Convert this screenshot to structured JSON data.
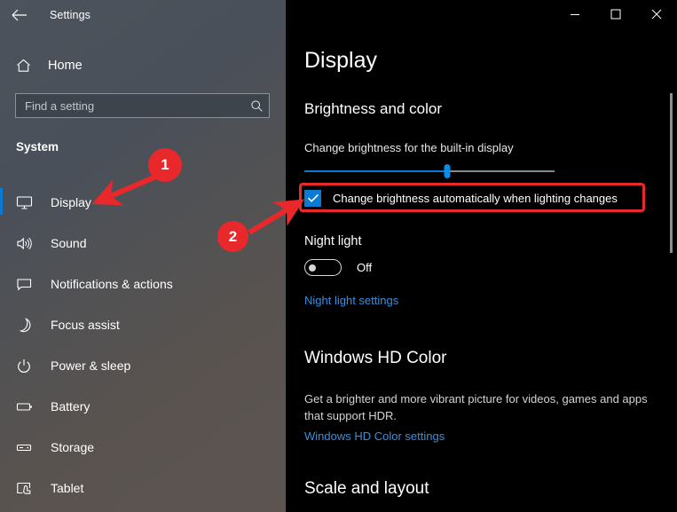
{
  "window": {
    "app_title": "Settings",
    "back_icon": "back-arrow-icon",
    "controls": {
      "minimize": "–",
      "maximize": "□",
      "close": "✕"
    }
  },
  "sidebar": {
    "home_label": "Home",
    "home_icon": "home-icon",
    "search": {
      "placeholder": "Find a setting",
      "value": "",
      "icon": "search-icon"
    },
    "section_title": "System",
    "items": [
      {
        "label": "Display",
        "icon": "monitor-icon",
        "selected": true
      },
      {
        "label": "Sound",
        "icon": "speaker-icon",
        "selected": false
      },
      {
        "label": "Notifications & actions",
        "icon": "notification-icon",
        "selected": false
      },
      {
        "label": "Focus assist",
        "icon": "moon-icon",
        "selected": false
      },
      {
        "label": "Power & sleep",
        "icon": "power-icon",
        "selected": false
      },
      {
        "label": "Battery",
        "icon": "battery-icon",
        "selected": false
      },
      {
        "label": "Storage",
        "icon": "storage-icon",
        "selected": false
      },
      {
        "label": "Tablet",
        "icon": "tablet-icon",
        "selected": false
      }
    ]
  },
  "main": {
    "page_title": "Display",
    "brightness": {
      "heading": "Brightness and color",
      "slider_label": "Change brightness for the built-in display",
      "slider_value": 57,
      "auto_checkbox_label": "Change brightness automatically when lighting changes",
      "auto_checkbox_checked": true
    },
    "night_light": {
      "heading": "Night light",
      "toggle_state": "Off",
      "toggle_on": false,
      "settings_link": "Night light settings"
    },
    "hd_color": {
      "heading": "Windows HD Color",
      "description": "Get a brighter and more vibrant picture for videos, games and apps that support HDR.",
      "settings_link": "Windows HD Color settings"
    },
    "scale": {
      "heading": "Scale and layout"
    }
  },
  "annotations": {
    "color": "#e8282b",
    "markers": [
      {
        "number": "1",
        "target": "sidebar-item-display"
      },
      {
        "number": "2",
        "target": "auto-brightness-checkbox"
      }
    ]
  }
}
